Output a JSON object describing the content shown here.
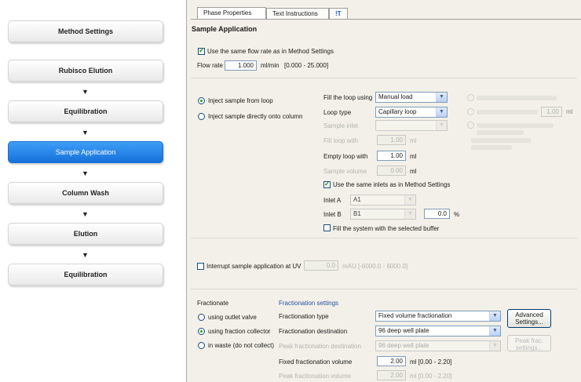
{
  "steps": [
    {
      "label": "Method Settings"
    },
    {
      "label": "Rubisco Elution"
    },
    {
      "label": "Equilibration"
    },
    {
      "label": "Sample Application"
    },
    {
      "label": "Column Wash"
    },
    {
      "label": "Elution"
    },
    {
      "label": "Equilibration"
    }
  ],
  "arrow_glyph": "▼",
  "tabs": [
    {
      "label": "Phase Properties"
    },
    {
      "label": "Text Instructions"
    },
    {
      "label": "!T"
    }
  ],
  "section_title": "Sample Application",
  "flow": {
    "same_flow_label": "Use the same flow rate as in Method Settings",
    "rate_label": "Flow rate",
    "rate_value": "1.000",
    "rate_unit": "ml/min",
    "rate_range": "[0.000 - 25.000]"
  },
  "inject": {
    "from_loop": "Inject sample from loop",
    "direct": "Inject sample directly onto column"
  },
  "loop": {
    "fill_using_label": "Fill the loop using",
    "fill_using_value": "Manual load",
    "loop_type_label": "Loop type",
    "loop_type_value": "Capillary loop",
    "sample_inlet_label": "Sample inlet",
    "fill_with_label": "Fill loop with",
    "fill_with_value": "1.00",
    "empty_with_label": "Empty loop with",
    "empty_with_value": "1.00",
    "sample_volume_label": "Sample volume",
    "sample_volume_value": "0.00",
    "unit_ml": "ml",
    "same_inlets_label": "Use the same inlets as in Method Settings",
    "inlet_a_label": "Inlet A",
    "inlet_a_value": "A1",
    "inlet_b_label": "Inlet B",
    "inlet_b_value": "B1",
    "inlet_b_percent": "0.0",
    "percent_unit": "%",
    "fill_system_label": "Fill the system with the selected buffer"
  },
  "right_dim": {
    "vol_value": "1.00",
    "unit": "ml"
  },
  "interrupt": {
    "label": "Interrupt sample application at UV",
    "value": "0.0",
    "range": "mAU  [-6000.0 - 6000.0]"
  },
  "fraction": {
    "heading": "Fractionate",
    "opt_outlet": "using outlet valve",
    "opt_collector": "using fraction collector",
    "opt_waste": "in waste (do not collect)",
    "settings_heading": "Fractionation settings",
    "type_label": "Fractionation type",
    "type_value": "Fixed volume fractionation",
    "dest_label": "Fractionation destination",
    "dest_value": "96 deep well plate",
    "peak_dest_label": "Peak fractionation destination",
    "peak_dest_value": "96 deep well plate",
    "fixed_vol_label": "Fixed fractionation volume",
    "fixed_vol_value": "2.00",
    "fixed_vol_range": "ml [0.00 - 2.20]",
    "peak_vol_label": "Peak fractionation volume",
    "peak_vol_value": "2.00",
    "peak_vol_range": "ml [0.00 - 2.20]",
    "advanced_btn": "Advanced Settings...",
    "peak_btn": "Peak frac. settings..."
  }
}
